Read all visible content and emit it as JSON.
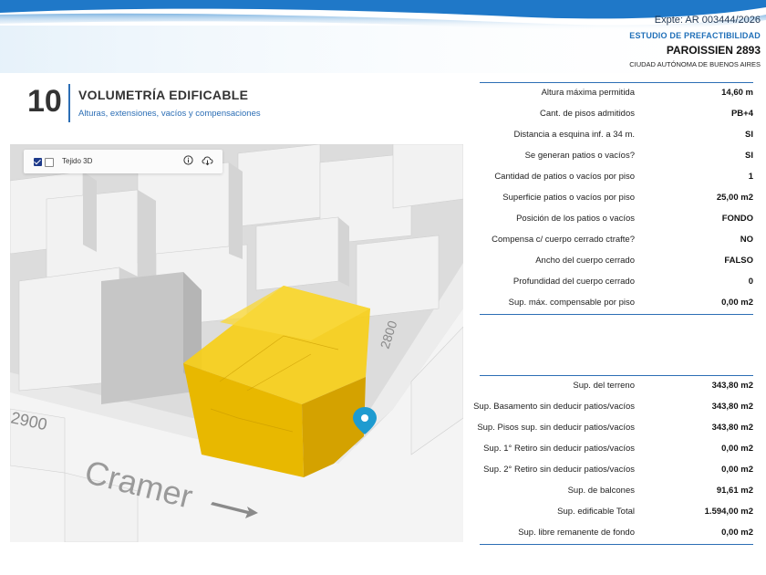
{
  "header": {
    "expte": "Expte: AR 003444/2026",
    "estudio": "ESTUDIO DE PREFACTIBILIDAD",
    "address": "PAROISSIEN 2893",
    "city": "CIUDAD AUTÓNOMA DE BUENOS AIRES"
  },
  "section": {
    "number": "10",
    "title": "VOLUMETRÍA EDIFICABLE",
    "subtitle": "Alturas, extensiones, vacíos y compensaciones"
  },
  "map": {
    "layer_label": "Tejido 3D",
    "street_label": "Cramer",
    "number_left": "2900",
    "number_right": "2800",
    "info_icon": "info-icon",
    "cloud_icon": "cloud-download-icon",
    "pin_icon": "location-pin-icon",
    "colors": {
      "volume": "#f2c200",
      "buildings": "#f0f0f0",
      "pin": "#1e9bd0"
    }
  },
  "table1": {
    "rows": [
      {
        "label": "Altura máxima permitida",
        "value": "14,60 m"
      },
      {
        "label": "Cant. de pisos admitidos",
        "value": "PB+4"
      },
      {
        "label": "Distancia a esquina inf. a 34 m.",
        "value": "SI"
      },
      {
        "label": "Se generan patios o vacíos?",
        "value": "SI"
      },
      {
        "label": "Cantidad de patios o vacíos por piso",
        "value": "1"
      },
      {
        "label": "Superficie patios o vacíos por piso",
        "value": "25,00 m2"
      },
      {
        "label": "Posición de los patios o vacíos",
        "value": "FONDO"
      },
      {
        "label": "Compensa c/ cuerpo cerrado ctrafte?",
        "value": "NO"
      },
      {
        "label": "Ancho del  cuerpo cerrado",
        "value": "FALSO"
      },
      {
        "label": "Profundidad del  cuerpo cerrado",
        "value": "0"
      },
      {
        "label": "Sup. máx. compensable por piso",
        "value": "0,00 m2"
      }
    ]
  },
  "table2": {
    "rows": [
      {
        "label": "Sup. del terreno",
        "value": "343,80 m2"
      },
      {
        "label": "Sup. Basamento sin deducir patios/vacíos",
        "value": "343,80 m2"
      },
      {
        "label": "Sup. Pisos sup. sin deducir patios/vacíos",
        "value": "343,80 m2"
      },
      {
        "label": "Sup. 1° Retiro sin deducir patios/vacíos",
        "value": "0,00 m2"
      },
      {
        "label": "Sup. 2° Retiro sin deducir patios/vacíos",
        "value": "0,00 m2"
      },
      {
        "label": "Sup. de balcones",
        "value": "91,61 m2"
      },
      {
        "label": "Sup. edificable Total",
        "value": "1.594,00 m2"
      },
      {
        "label": "Sup. libre remanente de fondo",
        "value": "0,00 m2"
      }
    ]
  },
  "colors": {
    "accent": "#2c6eb5",
    "wave": "#3a8fd6"
  }
}
